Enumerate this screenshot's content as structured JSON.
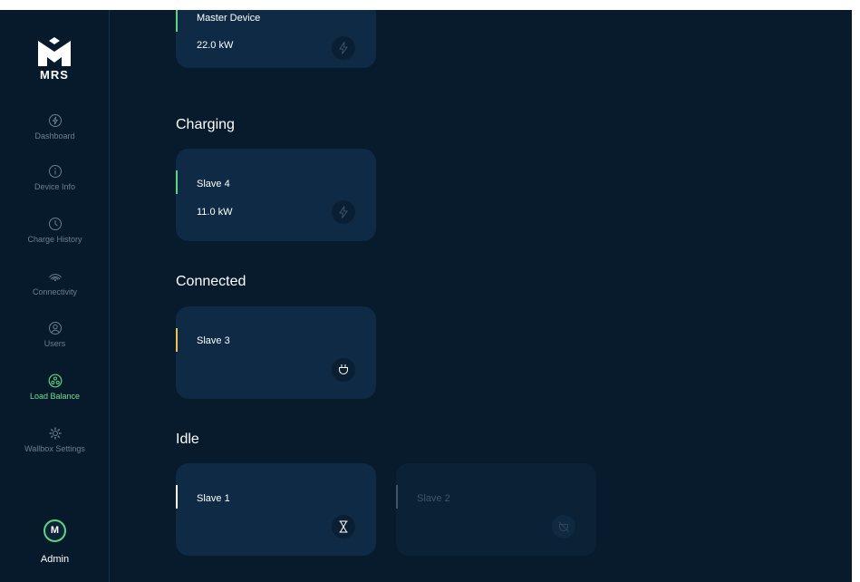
{
  "brand": {
    "logo_text": "MRS"
  },
  "sidebar": {
    "items": [
      {
        "label": "Dashboard",
        "icon": "dashboard-icon",
        "active": false
      },
      {
        "label": "Device Info",
        "icon": "info-icon",
        "active": false
      },
      {
        "label": "Charge History",
        "icon": "clock-icon",
        "active": false
      },
      {
        "label": "Connectivity",
        "icon": "wifi-icon",
        "active": false
      },
      {
        "label": "Users",
        "icon": "user-icon",
        "active": false
      },
      {
        "label": "Load Balance",
        "icon": "load-balance-icon",
        "active": true
      },
      {
        "label": "Wallbox Settings",
        "icon": "gear-icon",
        "active": false
      }
    ],
    "user": {
      "avatar": "M",
      "name": "Admin"
    }
  },
  "colors": {
    "background": "#071b2c",
    "card": "#0e2a44",
    "accent_green": "#5fd47f",
    "accent_yellow": "#f2c14e",
    "muted_text": "#6b7f92"
  },
  "master": {
    "name": "Master Device",
    "power": "22.0 kW",
    "icon": "bolt-icon"
  },
  "sections": {
    "charging": {
      "title": "Charging",
      "devices": [
        {
          "name": "Slave 4",
          "power": "11.0 kW",
          "icon": "bolt-icon"
        }
      ]
    },
    "connected": {
      "title": "Connected",
      "devices": [
        {
          "name": "Slave 3",
          "icon": "plug-icon"
        }
      ]
    },
    "idle": {
      "title": "Idle",
      "devices": [
        {
          "name": "Slave 1",
          "icon": "hourglass-icon"
        },
        {
          "name": "Slave 2",
          "icon": "plug-off-icon",
          "disabled": true
        }
      ]
    }
  }
}
